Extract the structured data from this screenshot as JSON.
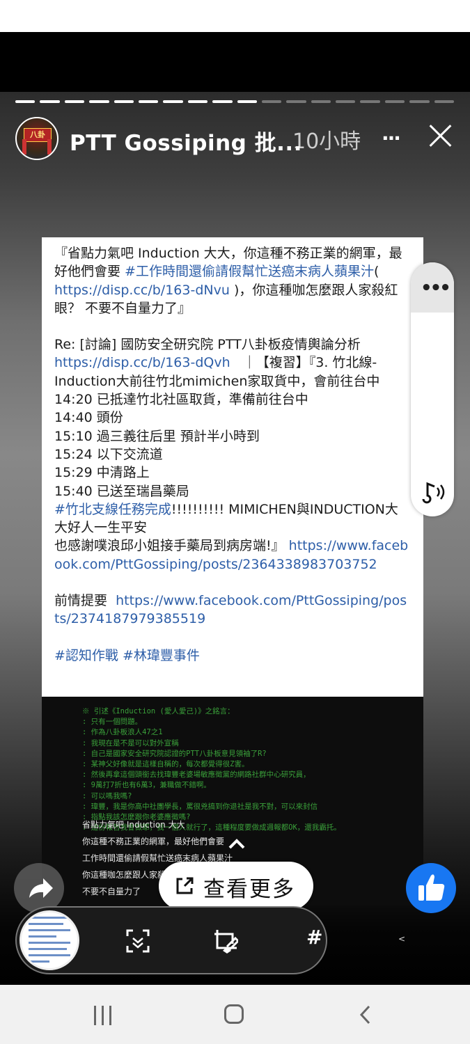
{
  "header": {
    "page_name": "PTT Gossiping 批...",
    "time": "10小時",
    "more_label": "···",
    "progress_total": 18,
    "progress_done": 10
  },
  "post": {
    "paragraph1_a": "『省點力氣吧 Induction 大大，你這種不務正業的網軍，最好他們會要 ",
    "paragraph1_hashtag": "#工作時間還偷請假幫忙送癌末病人蘋果汁",
    "paragraph1_b": "(",
    "paragraph1_link": "https://disp.cc/b/163-dNvu",
    "paragraph1_c": ")，你這種咖怎麼跟人家殺紅眼？ 不要不自量力了』",
    "re_title": "Re: [討論] 國防安全研究院 PTT八卦板疫情輿論分析",
    "re_link": "https://disp.cc/b/163-dQvh",
    "re_after": "｜【複習】『3. 竹北線-Induction大前往竹北mimichen家取貨中，會前往台中",
    "lines": [
      "14:20 已抵達竹北社區取貨，準備前往台中",
      "14:40 頭份",
      "15:10 過三義往后里 預計半小時到",
      "15:24 以下交流道",
      "15:29 中清路上",
      "15:40 已送至瑞昌藥局"
    ],
    "mission_hashtag": "#竹北支線任務完成",
    "mission_text": "!!!!!!!!!! MIMICHEN與INDUCTION大大好人一生平安",
    "thanks_text": "也感謝噗浪邱小姐接手藥局到病房端!』",
    "thanks_link": "https://www.facebook.com/PttGossiping/posts/2364338983703752",
    "prev_label": "前情提要",
    "prev_link": "https://www.facebook.com/PttGossiping/posts/2374187979385519",
    "tag1": "#認知作戰",
    "tag2": "#林瑋豐事件"
  },
  "terminal": {
    "lines": [
      "※ 引述《Induction (愛人愛己)》之銘言：",
      ": 只有一個問題。",
      ": 作為八卦板浪人47之1",
      ": 我現在是不是可以對外宣稱",
      ": 自己是國家安全研究院認證的PTT八卦板意見領袖了R?",
      ": 某神父好像就是這樣自稱的，每次都覺得很Z害。",
      ": 然後再拿這個頭銜去找瑋豐老婆場敏應徵黨的網路社群中心研究員，",
      ": 9萬打7折也有6萬3，兼職做不錯啊。",
      ": 可以嗎我嗎?",
      ": 瑋豐，我是你高中社團學長，罵很兇搞到你退社是我不對，可以來封信",
      ": 指點我該怎麼跟你老婆應徵嗎?",
      ": 這份報告我會做耶，我一個人就行了，這種程度要做成週報都OK，還我霸托。"
    ],
    "plain": [
      "省點力氣吧 Induction 大大",
      "你這種不務正業的網軍，最好他們會要",
      "工作時間還偷請假幫忙送癌末病人蘋果汁",
      "你這種咖怎麼跟人家殺",
      "不要不自量力了"
    ]
  },
  "actions": {
    "see_more": "查看更多",
    "hash_label": "#",
    "tiny_chevron": "<"
  },
  "colors": {
    "link": "#2d5ea8",
    "like": "#1877f2",
    "terminal_text": "#3aa03a"
  },
  "icons": [
    "close-icon",
    "more-dots-icon",
    "sound-icon",
    "share-icon",
    "like-icon",
    "external-link-icon",
    "chevron-up-icon",
    "text-scan-icon",
    "sticker-edit-icon",
    "hash-icon",
    "nav-recent-icon",
    "nav-home-icon",
    "nav-back-icon"
  ]
}
